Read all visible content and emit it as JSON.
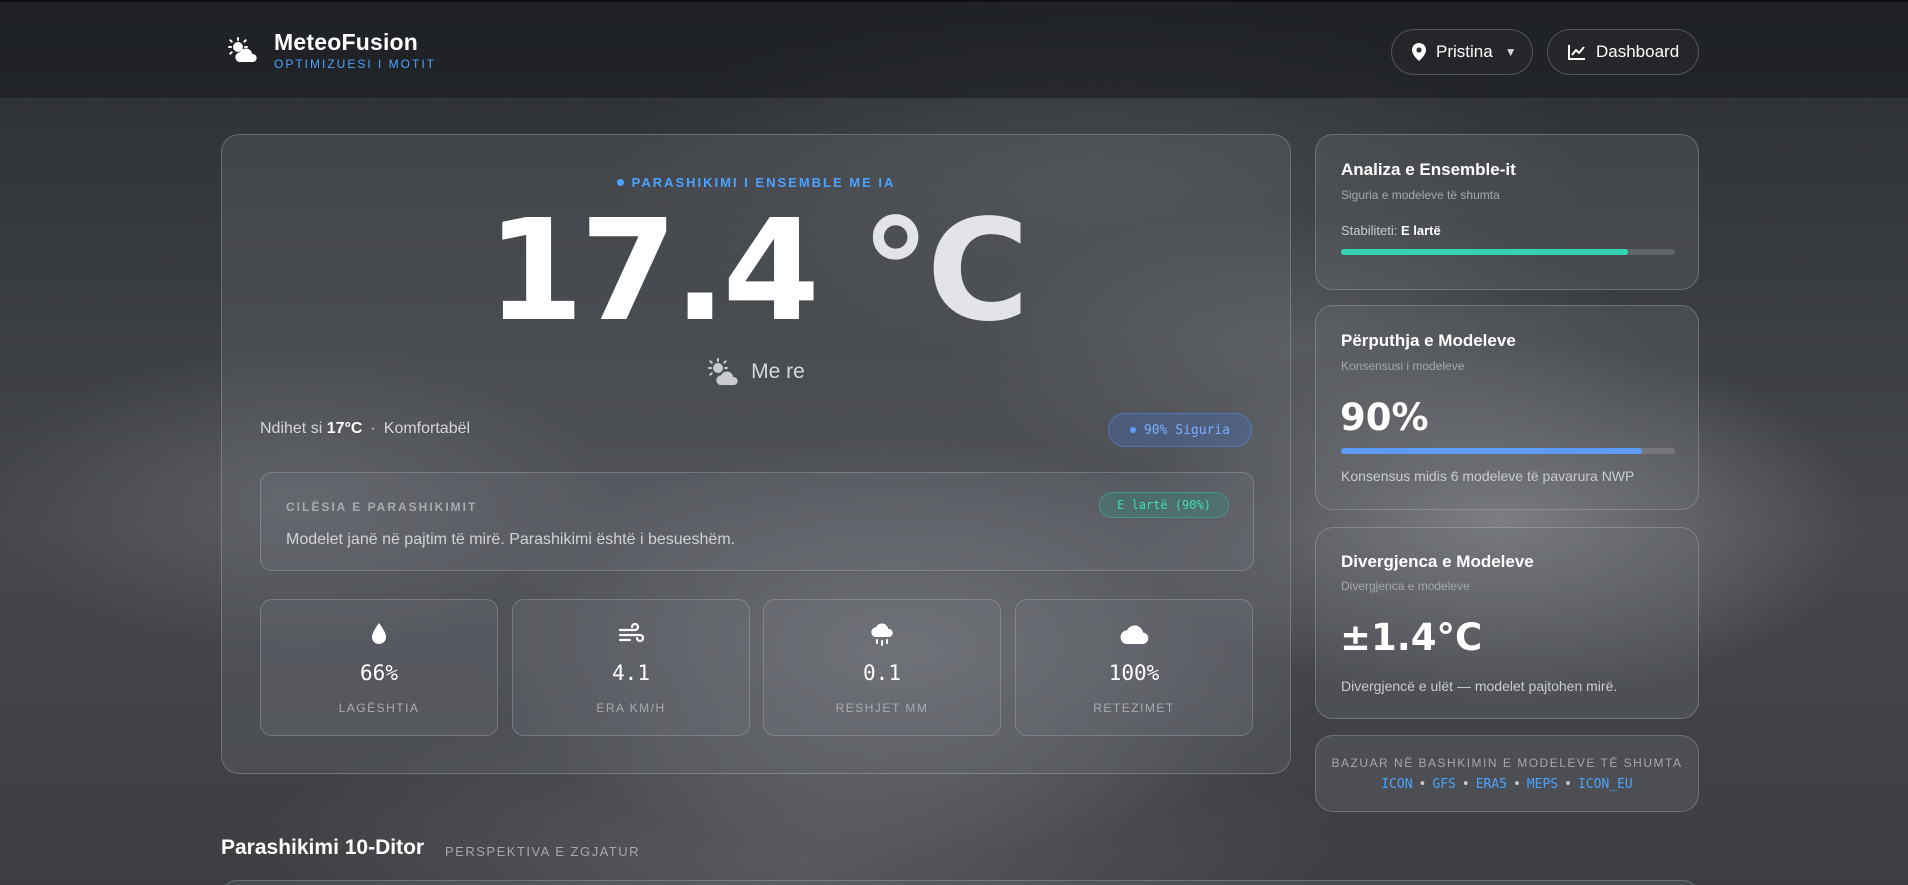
{
  "app": {
    "name": "MeteoFusion",
    "tagline": "OPTIMIZUESI I MOTIT"
  },
  "header": {
    "location": "Pristina",
    "dashboard_label": "Dashboard"
  },
  "current": {
    "ai_label": "PARASHIKIMI I ENSEMBLE ME IA",
    "temperature": "17.4",
    "unit": "°C",
    "condition": "Me re",
    "feels_label": "Ndihet si",
    "feels_value": "17°C",
    "separator": "·",
    "comfort": "Komfortabël",
    "confidence_badge": "90% Siguria"
  },
  "quality": {
    "title": "CILËSIA E PARASHIKIMIT",
    "badge": "E lartë (90%)",
    "text": "Modelet janë në pajtim të mirë. Parashikimi është i besueshëm."
  },
  "stats": [
    {
      "icon": "droplet-icon",
      "value": "66%",
      "label": "LAGËSHTIA"
    },
    {
      "icon": "wind-icon",
      "value": "4.1",
      "label": "ERA KM/H"
    },
    {
      "icon": "cloud-rain-icon",
      "value": "0.1",
      "label": "RESHJET MM"
    },
    {
      "icon": "cloud-icon",
      "value": "100%",
      "label": "RETEZIMET"
    }
  ],
  "ensemble": {
    "title": "Analiza e Ensemble-it",
    "subtitle": "Siguria e modeleve të shumta",
    "stability_label": "Stabiliteti:",
    "stability_value": "E lartë",
    "stability_fraction": 0.86,
    "bar_color": "#34d3b4"
  },
  "agreement": {
    "title": "Përputhja e Modeleve",
    "subtitle": "Konsensusi i modeleve",
    "value": "90%",
    "fraction": 0.9,
    "note": "Konsensus midis 6 modeleve të pavarura NWP",
    "bar_color": "#5b9df5"
  },
  "divergence": {
    "title": "Divergjenca e Modeleve",
    "subtitle": "Divergjenca e modeleve",
    "value": "±1.4°C",
    "note": "Divergjencë e ulët — modelet pajtohen mirë."
  },
  "sources": {
    "title": "BAZUAR NË BASHKIMIN E MODELEVE TË SHUMTA",
    "models": [
      "ICON",
      "GFS",
      "ERA5",
      "MEPS",
      "ICON_EU"
    ],
    "separator": "•"
  },
  "forecast": {
    "title": "Parashikimi 10-Ditor",
    "subtitle": "PERSPEKTIVA E ZGJATUR"
  },
  "colors": {
    "accent": "#4aa3ff",
    "success": "#3ddcbc"
  }
}
